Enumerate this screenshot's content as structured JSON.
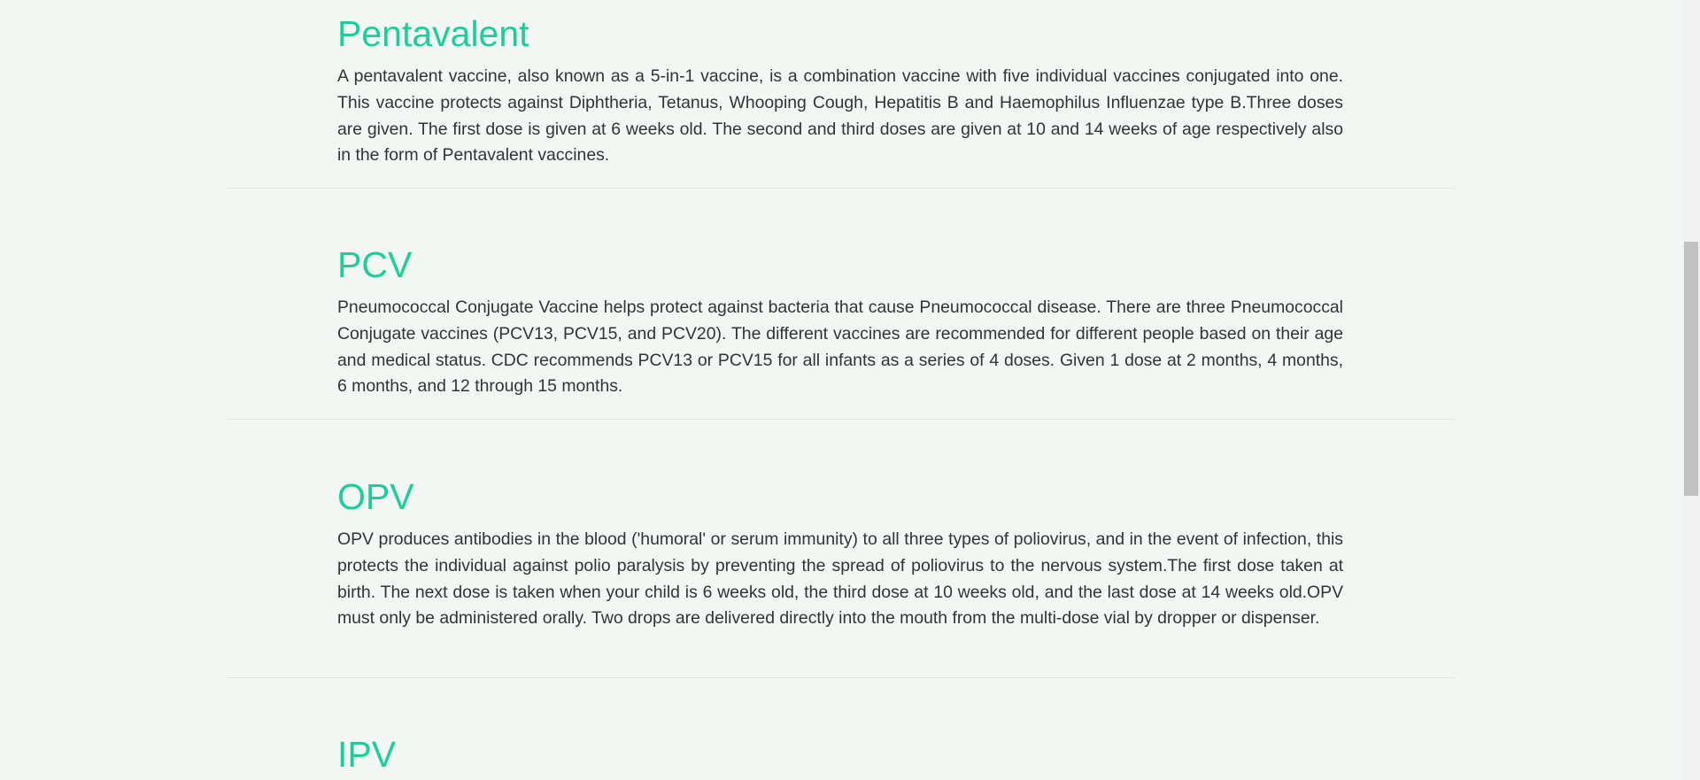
{
  "sections": [
    {
      "title": "Pentavalent",
      "body": "A pentavalent vaccine, also known as a 5-in-1 vaccine, is a combination vaccine with five individual vaccines conjugated into one. This vaccine protects against Diphtheria, Tetanus, Whooping Cough, Hepatitis B and Haemophilus Influenzae type B.Three doses are given. The first dose is given at 6 weeks old. The second and third doses are given at 10 and 14 weeks of age respectively also in the form of Pentavalent vaccines."
    },
    {
      "title": "PCV",
      "body": "Pneumococcal Conjugate Vaccine helps protect against bacteria that cause Pneumococcal disease. There are three Pneumococcal Conjugate vaccines (PCV13, PCV15, and PCV20). The different vaccines are recommended for different people based on their age and medical status. CDC recommends PCV13 or PCV15 for all infants as a series of 4 doses. Given 1 dose at 2 months, 4 months, 6 months, and 12 through 15 months."
    },
    {
      "title": "OPV",
      "body": "OPV produces antibodies in the blood ('humoral' or serum immunity) to all three types of poliovirus, and in the event of infection, this protects the individual against polio paralysis by preventing the spread of poliovirus to the nervous system.The first dose taken at birth. The next dose is taken when your child is 6 weeks old, the third dose at 10 weeks old, and the last dose at 14 weeks old.OPV must only be administered orally. Two drops are delivered directly into the mouth from the multi-dose vial by dropper or dispenser."
    },
    {
      "title": "IPV"
    }
  ],
  "colors": {
    "heading": "#1ccf9a",
    "body_text": "#333333",
    "background": "#f3f7f4",
    "divider": "#e1e6e3"
  }
}
